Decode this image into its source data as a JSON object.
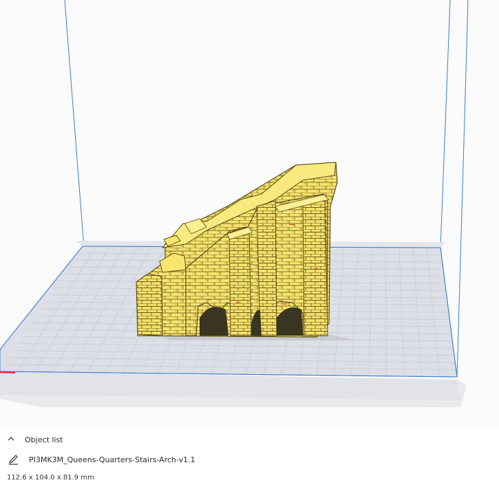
{
  "object_list": {
    "toggle_label": "Object list",
    "toggle_icon": "chevron-up-icon",
    "object_name": "PI3MK3M_Queens-Quarters-Stairs-Arch-v1.1",
    "edit_icon": "pencil-icon",
    "dimensions": "112.6 x 104.0 x 81.9 mm"
  },
  "colors": {
    "build_volume_edge": "#3a7bd5",
    "plate": "#dadde3",
    "grid": "#c8ccd4",
    "model": "#f7e774",
    "model_shade": "#c9b84a",
    "model_outline": "#5a4a1a",
    "accent_red": "#d03030"
  }
}
